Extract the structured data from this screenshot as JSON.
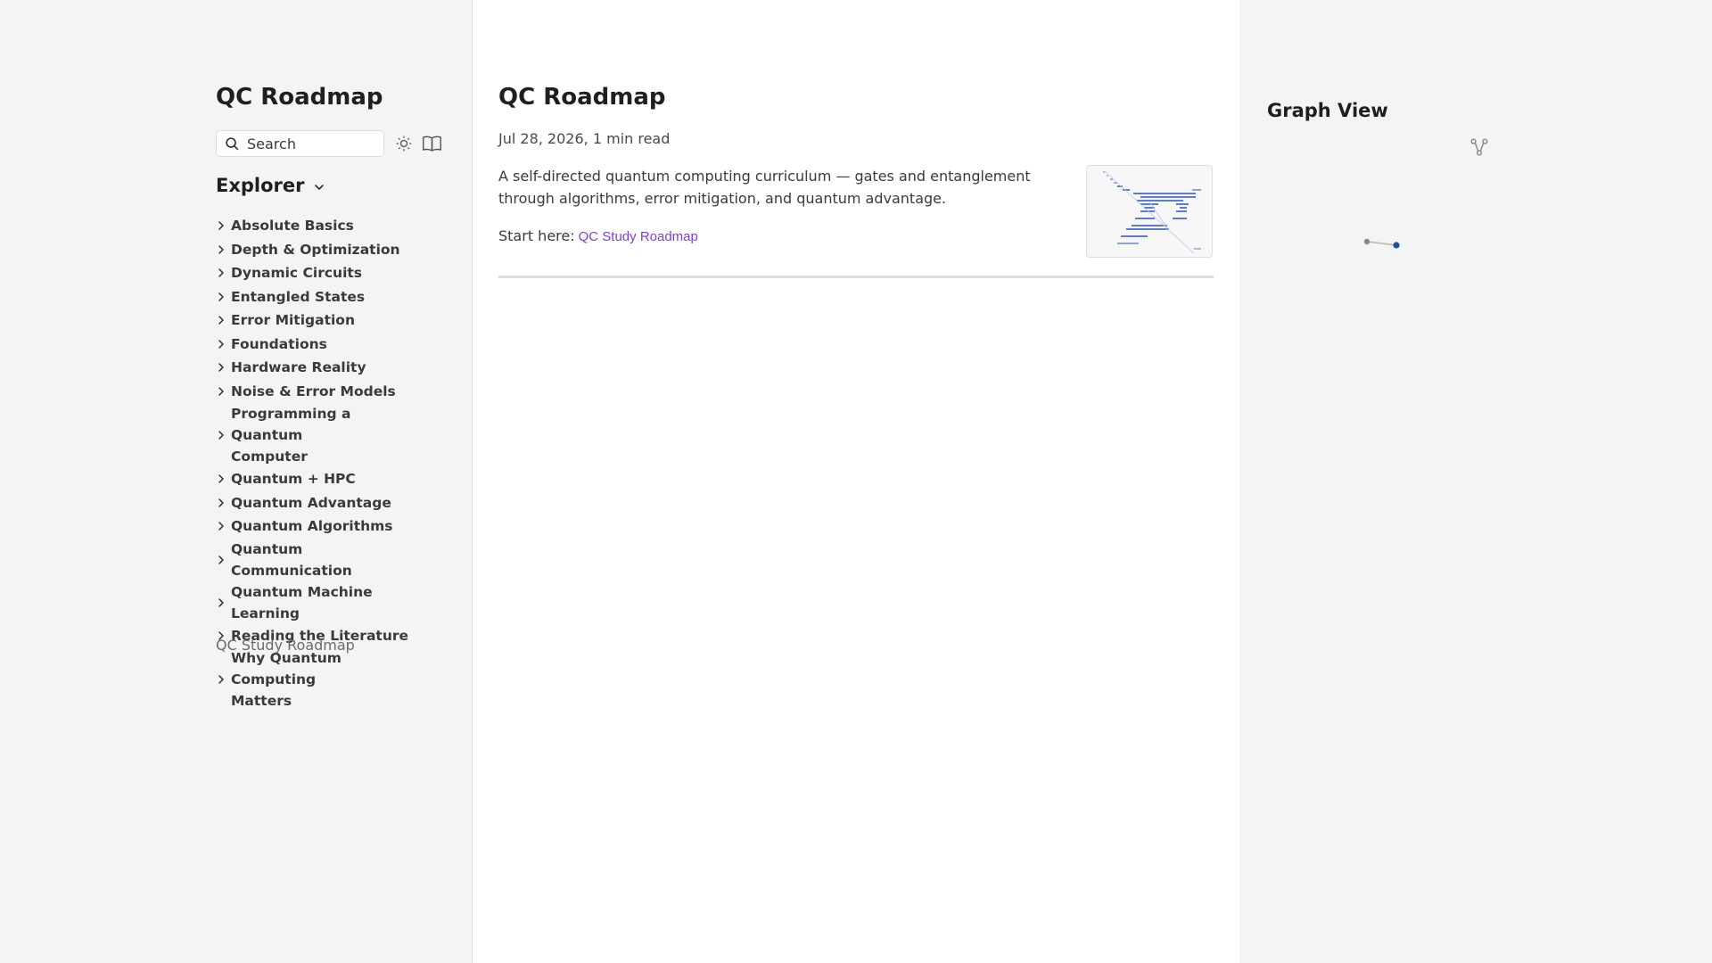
{
  "sidebar": {
    "site_title": "QC Roadmap",
    "search_placeholder": "Search",
    "explorer_label": "Explorer",
    "folders": [
      "Absolute Basics",
      "Depth & Optimization",
      "Dynamic Circuits",
      "Entangled States",
      "Error Mitigation",
      "Foundations",
      "Hardware Reality",
      "Noise & Error Models",
      "Programming a Quantum Computer",
      "Quantum + HPC",
      "Quantum Advantage",
      "Quantum Algorithms",
      "Quantum Communication",
      "Quantum Machine Learning",
      "Reading the Literature",
      "Why Quantum Computing Matters"
    ],
    "page_link": "QC Study Roadmap"
  },
  "article": {
    "title": "QC Roadmap",
    "date": "Jul 28, 2026,",
    "read_time": "1 min read",
    "description": "A self-directed quantum computing curriculum — gates and entanglement through algorithms, error mitigation, and quantum advantage.",
    "start_label": "Start here:",
    "start_link": "QC Study Roadmap"
  },
  "graph": {
    "title": "Graph View"
  },
  "colors": {
    "accent_link": "#7b3fd9",
    "graph_node_active": "#1f4fa3",
    "graph_node": "#8a8a8a"
  }
}
